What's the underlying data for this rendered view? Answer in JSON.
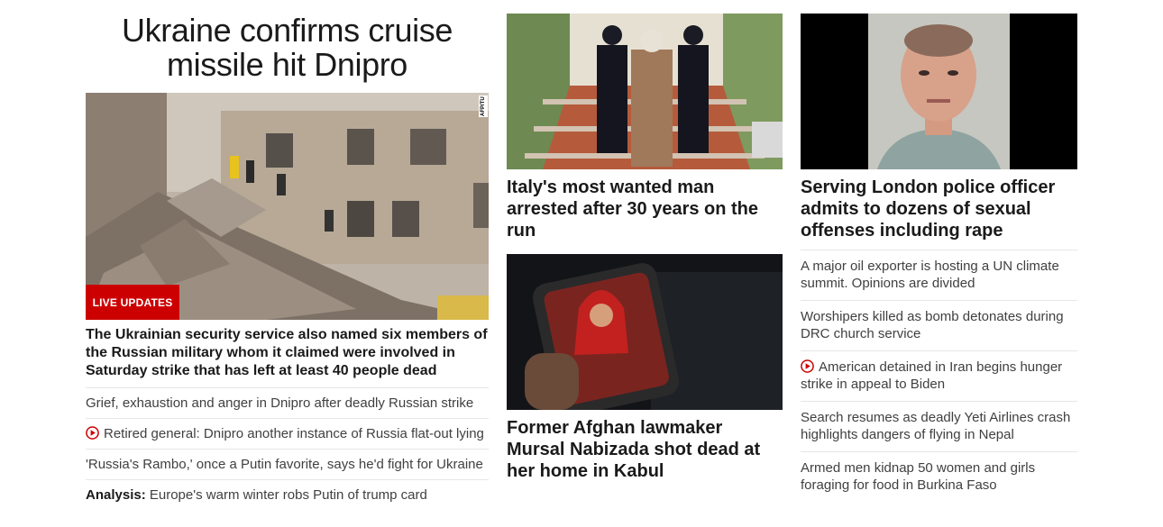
{
  "lead": {
    "headline": "Ukraine confirms cruise missile hit Dnipro",
    "badge": "LIVE UPDATES",
    "photo_credit": "AFP/TU",
    "caption": "The Ukrainian security service also named six members of the Russian military whom it claimed were involved in Saturday strike that has left at least 40 people dead",
    "related": [
      {
        "text": "Grief, exhaustion and anger in Dnipro after deadly Russian strike",
        "video": false
      },
      {
        "text": "Retired general: Dnipro another instance of Russia flat-out lying",
        "video": true
      },
      {
        "text": "'Russia's Rambo,' once a Putin favorite, says he'd fight for Ukraine",
        "video": false
      }
    ],
    "analysis": {
      "label": "Analysis:",
      "text": " Europe's warm winter robs Putin of trump card"
    }
  },
  "middle": {
    "story1": "Italy's most wanted man arrested after 30 years on the run",
    "story2": "Former Afghan lawmaker Mursal Nabizada shot dead at her home in Kabul"
  },
  "right": {
    "story": "Serving London police officer admits to dozens of sexual offenses including rape",
    "links": [
      {
        "text": "A major oil exporter is hosting a UN climate summit. Opinions are divided",
        "video": false
      },
      {
        "text": "Worshipers killed as bomb detonates during DRC church service",
        "video": false
      },
      {
        "text": "American detained in Iran begins hunger strike in appeal to Biden",
        "video": true
      },
      {
        "text": "Search resumes as deadly Yeti Airlines crash highlights dangers of flying in Nepal",
        "video": false
      },
      {
        "text": "Armed men kidnap 50 women and girls foraging for food in Burkina Faso",
        "video": false
      }
    ]
  },
  "colors": {
    "badge": "#cc0000",
    "play": "#cc0000",
    "text": "#1a1a1a",
    "link": "#404040",
    "divider": "#e6e6e6"
  }
}
